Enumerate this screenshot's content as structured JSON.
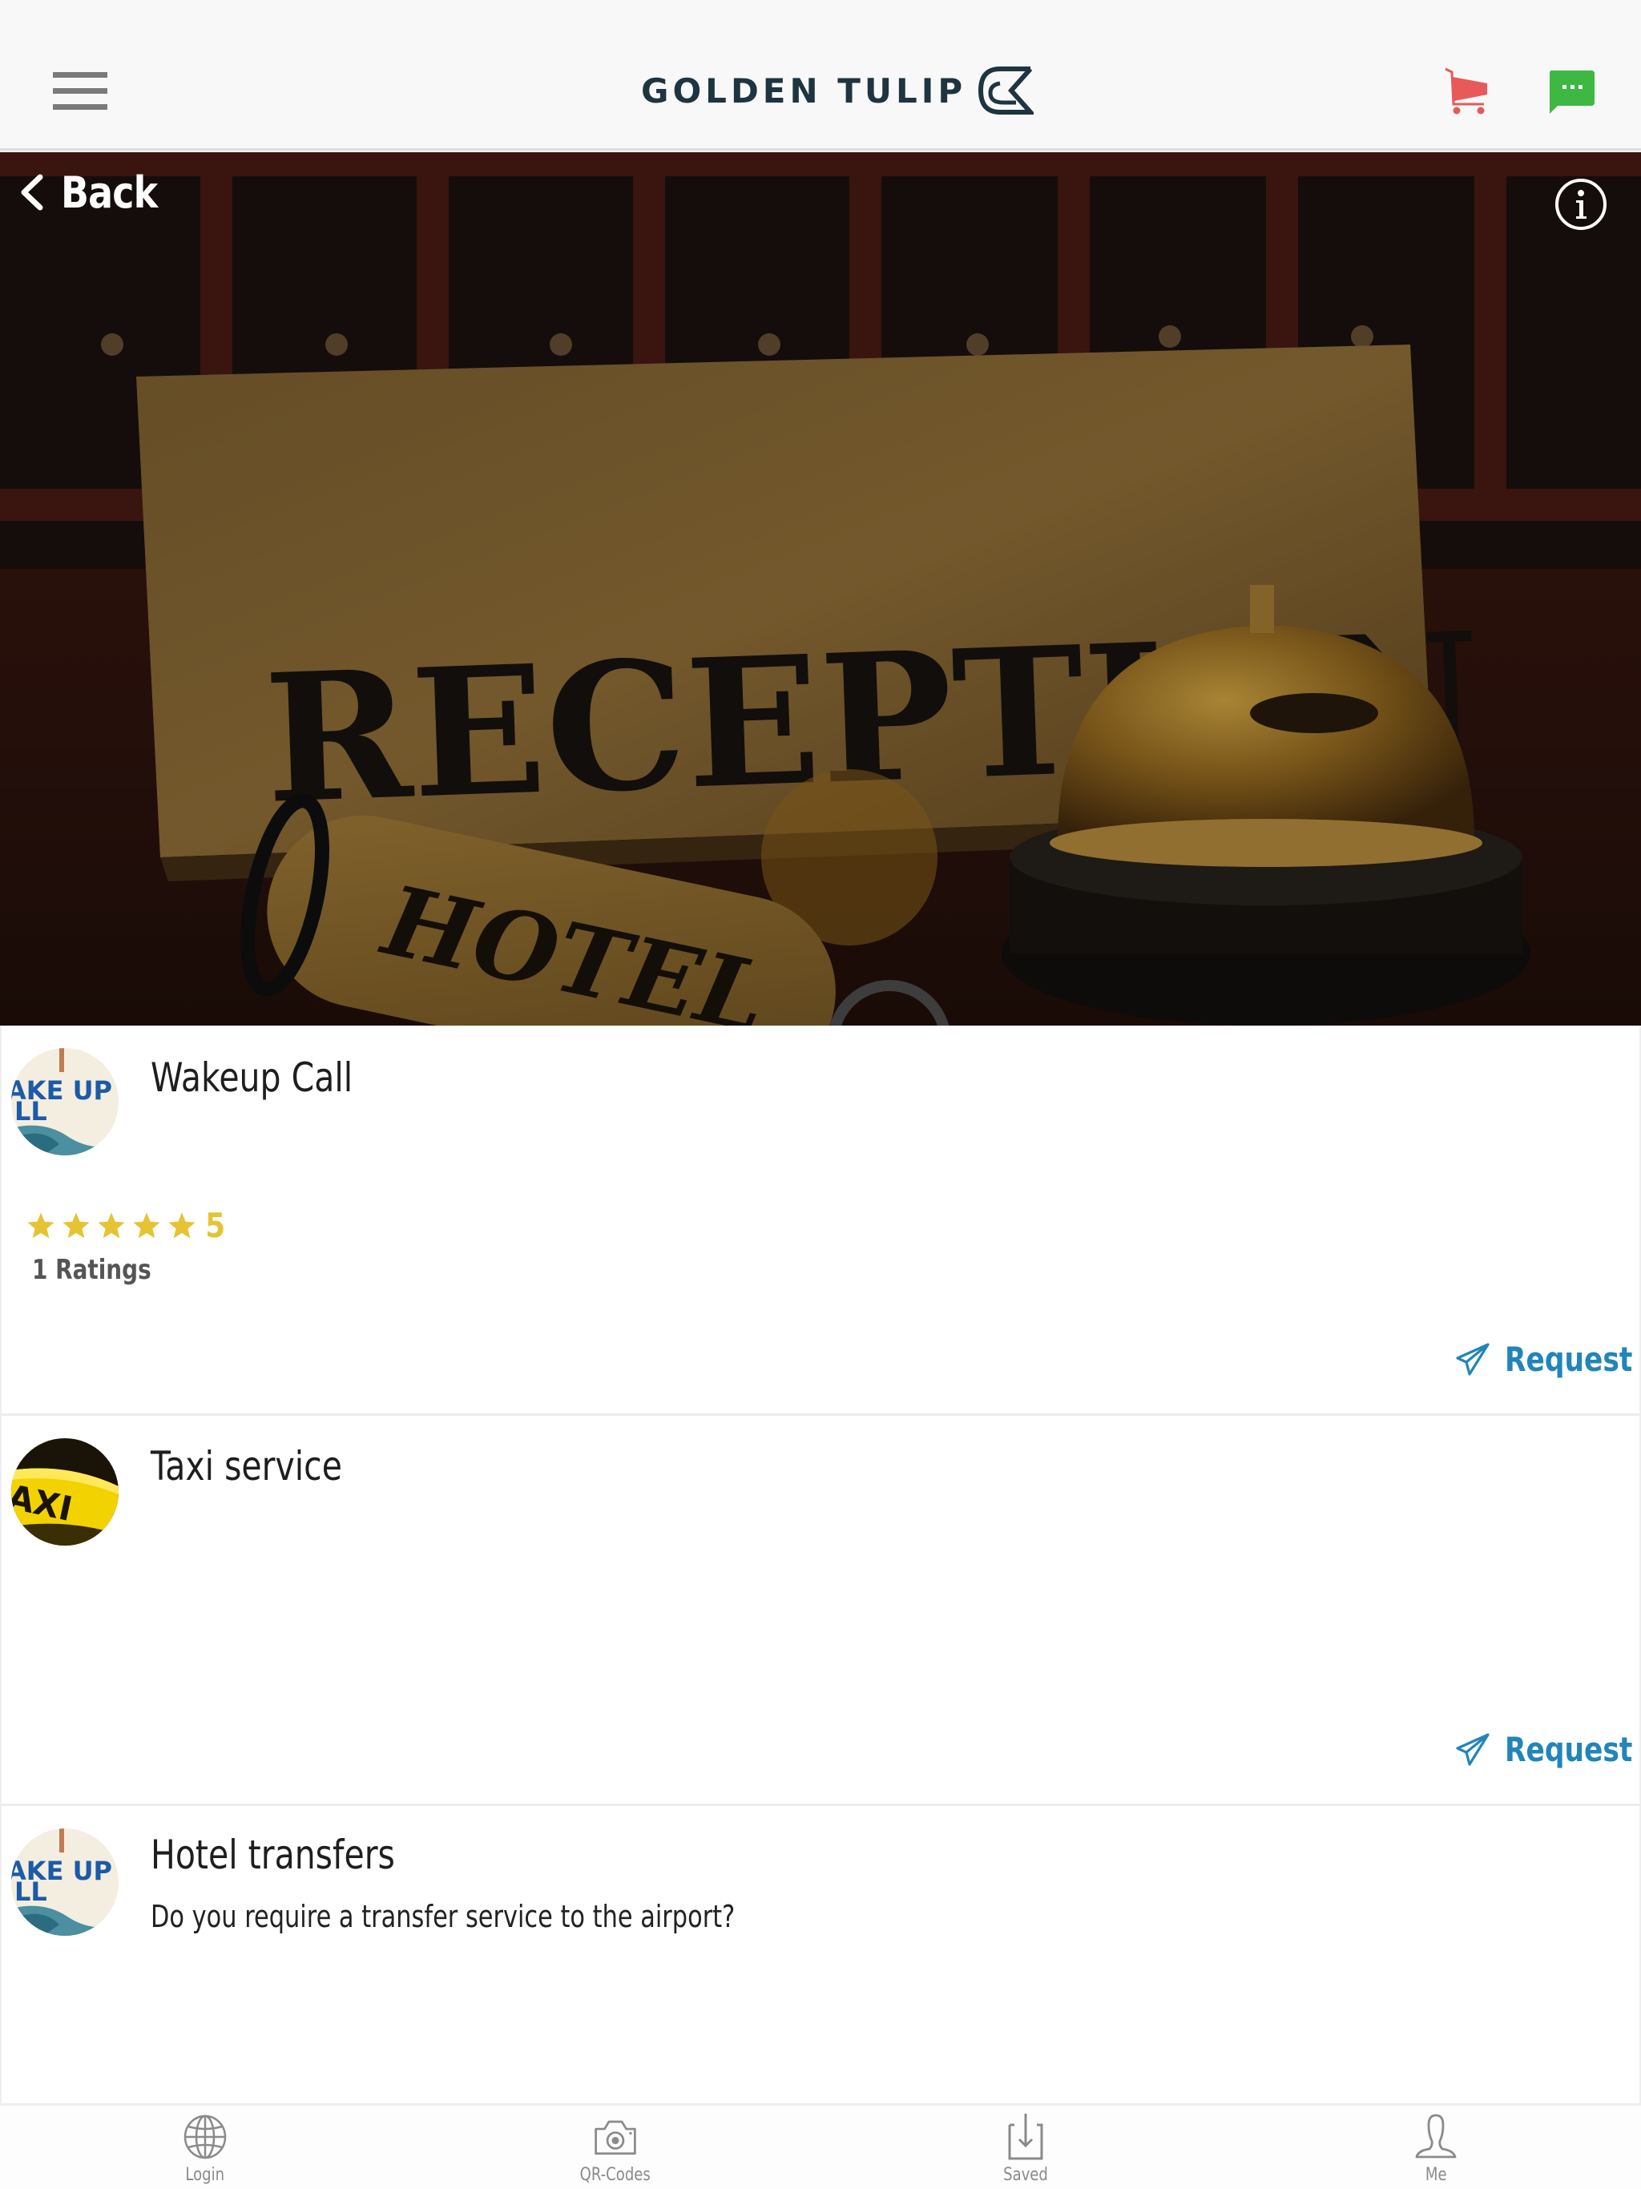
{
  "header": {
    "brand": "GOLDEN TULIP",
    "menu_icon": "hamburger-menu-icon",
    "cart_icon": "shopping-cart-icon",
    "chat_icon": "chat-bubble-icon",
    "colors": {
      "cart": "#e85a5a",
      "chat": "#3cb843",
      "brand": "#1f3441"
    }
  },
  "hero": {
    "back_label": "Back",
    "title": "RECEPTION",
    "info_icon": "info-icon",
    "image_sign_text": "RECEPTION",
    "image_keytag_text": "HOTEL"
  },
  "services": [
    {
      "title": "Wakeup Call",
      "description": "",
      "avatar_text": [
        "AKE UP",
        "LL"
      ],
      "rating": {
        "stars": 5,
        "max": 5,
        "value": "5",
        "count_label": "1 Ratings"
      },
      "request_label": "Request"
    },
    {
      "title": "Taxi service",
      "description": "",
      "avatar_text": [
        "AXI"
      ],
      "request_label": "Request"
    },
    {
      "title": "Hotel transfers",
      "description": "Do you require a transfer service to the airport?",
      "avatar_text": [
        "AKE UP",
        "LL"
      ]
    }
  ],
  "colors": {
    "accent": "#2185b9",
    "star": "#e6c333"
  },
  "bottom_nav": [
    {
      "label": "Login",
      "icon": "globe-icon"
    },
    {
      "label": "QR-Codes",
      "icon": "camera-icon"
    },
    {
      "label": "Saved",
      "icon": "download-icon"
    },
    {
      "label": "Me",
      "icon": "user-icon"
    }
  ]
}
